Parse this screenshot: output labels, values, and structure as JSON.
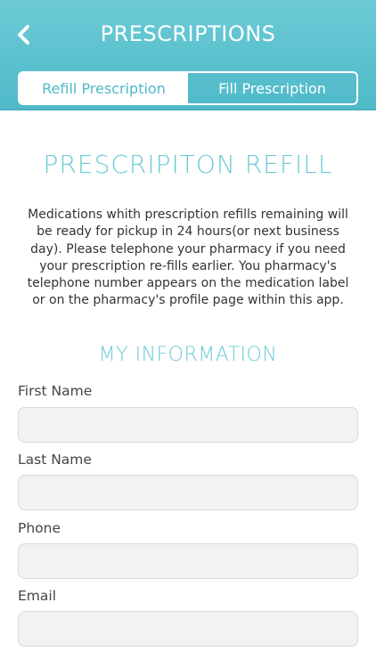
{
  "header": {
    "title": "PRESCRIPTIONS",
    "back_icon": "chevron-left-icon"
  },
  "tabs": [
    {
      "label": "Refill Prescription",
      "active": true
    },
    {
      "label": "Fill Prescription",
      "active": false
    }
  ],
  "main": {
    "heading": "PRESCRIPITON REFILL",
    "description": "Medications whith prescription refills remaining will be ready for pickup in 24 hours(or next business day). Please telephone your pharmacy if you need your prescription re-fills earlier. You pharmacy's telephone number appears on the medication label or on the pharmacy's profile page within this app.",
    "section_heading": "MY INFORMATION",
    "fields": [
      {
        "label": "First Name",
        "value": "",
        "placeholder": ""
      },
      {
        "label": "Last Name",
        "value": "",
        "placeholder": ""
      },
      {
        "label": "Phone",
        "value": "",
        "placeholder": ""
      },
      {
        "label": "Email",
        "value": "",
        "placeholder": ""
      }
    ]
  },
  "colors": {
    "accent": "#4fb9c8",
    "header_top": "#6ccbd6",
    "heading": "#6ccbd6",
    "input_bg": "#f2f2f2"
  }
}
